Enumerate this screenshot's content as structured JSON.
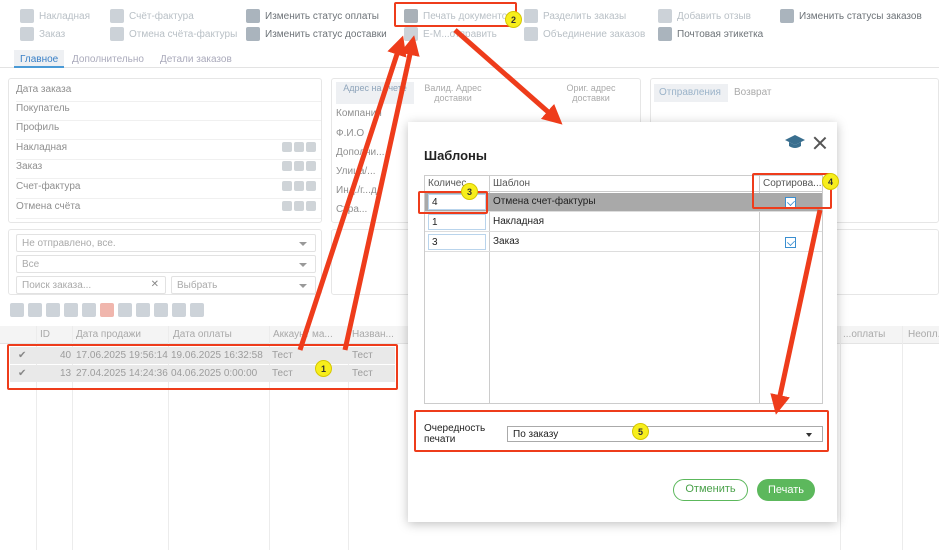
{
  "toolbar": {
    "invoice": "Накладная",
    "order": "Заказ",
    "schet": "Счёт-фактура",
    "cancel_schet": "Отмена счёта-фактуры",
    "change_payment": "Изменить статус оплаты",
    "change_delivery": "Изменить статус доставки",
    "print_docs": "Печать документов",
    "email_send": "E-M...отправить",
    "split_orders": "Разделить заказы",
    "merge_orders": "Объединение заказов",
    "add_review": "Добавить отзыв",
    "postal_label": "Почтовая этикетка",
    "change_order_status": "Изменить статусы заказов"
  },
  "tabs": [
    "Главное",
    "Дополнительно",
    "Детали заказов"
  ],
  "order_fields": [
    "Дата заказа",
    "Покупатель",
    "Профиль",
    "Накладная",
    "Заказ",
    "Счет-фактура",
    "Отмена счёта"
  ],
  "address": {
    "tabs": [
      "Адрес на счете",
      "Валид. Адрес доставки",
      "Ориг. адрес доставки"
    ],
    "fields": [
      "Компания",
      "Ф.И.О",
      "Дополни...",
      "Улица/...",
      "Инд./г...д",
      "Стра..."
    ]
  },
  "shipping_tabs": [
    "Отправления",
    "Возврат"
  ],
  "filters": {
    "status": "Не отправлено, все.",
    "all": "Все",
    "search_placeholder": "Поиск заказа...",
    "choose": "Выбрать"
  },
  "grid": {
    "headers": [
      "ID",
      "Дата продажи",
      "Дата оплаты",
      "Аккаунт ма...",
      "Назван...",
      "...оплаты",
      "Неопл..."
    ],
    "rows": [
      {
        "id": "40",
        "sale": "17.06.2025 19:56:14",
        "pay": "19.06.2025 16:32:58",
        "acc": "Тест",
        "name": "Тест"
      },
      {
        "id": "13",
        "sale": "27.04.2025 14:24:36",
        "pay": "04.06.2025 0:00:00",
        "acc": "Тест",
        "name": "Тест"
      }
    ]
  },
  "dialog": {
    "title": "Шаблоны",
    "col_qty": "Количес...",
    "col_template": "Шаблон",
    "col_sort": "Сортирова...",
    "rows": [
      {
        "qty": "4",
        "template": "Отмена счет-фактуры",
        "sort": true
      },
      {
        "qty": "1",
        "template": "Накладная",
        "sort": false
      },
      {
        "qty": "3",
        "template": "Заказ",
        "sort": true
      }
    ],
    "priority_label": "Очередность печати",
    "priority_value": "По заказу",
    "cancel": "Отменить",
    "print": "Печать"
  },
  "badges": [
    "1",
    "2",
    "3",
    "4",
    "5"
  ],
  "colors": {
    "callout": "#ee3c1b",
    "badge": "#f7ee1c",
    "accent_green": "#5cb85c",
    "accent_blue": "#3b8fd0"
  }
}
